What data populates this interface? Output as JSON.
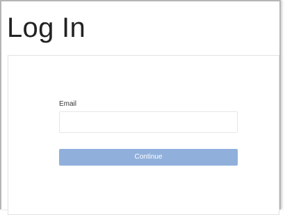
{
  "page": {
    "title": "Log In"
  },
  "form": {
    "email_label": "Email",
    "email_value": "",
    "email_placeholder": "",
    "continue_label": "Continue"
  },
  "colors": {
    "button_background": "#90afdb",
    "button_text": "#ffffff",
    "title_text": "#222222"
  }
}
